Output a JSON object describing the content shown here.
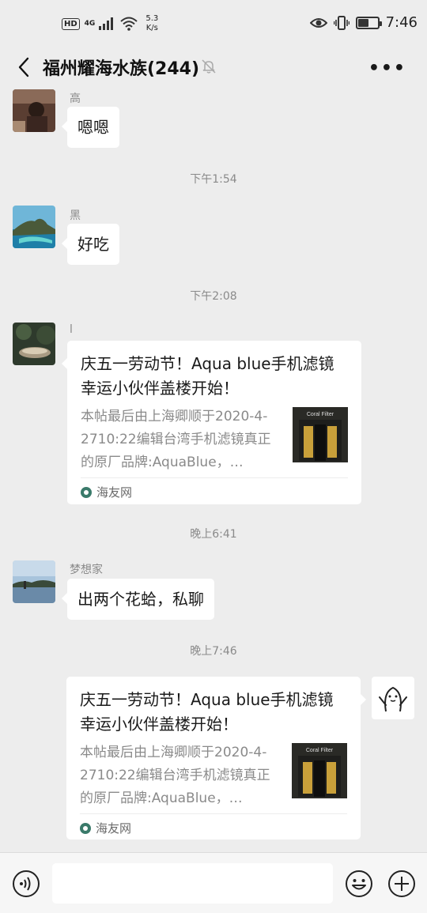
{
  "status_bar": {
    "hd": "HD",
    "network_type": "4G",
    "speed_value": "5.3",
    "speed_unit": "K/s",
    "time": "7:46",
    "battery_level": 0.55,
    "icons": [
      "eye-icon",
      "vibrate-icon",
      "battery-icon",
      "wifi-icon",
      "signal-icon"
    ]
  },
  "nav": {
    "title": "福州耀海水族(244)",
    "muted": true
  },
  "messages": [
    {
      "sender": "高",
      "text": "嗯嗯"
    },
    {
      "timestamp": "下午1:54"
    },
    {
      "sender": "黑",
      "text": "好吃"
    },
    {
      "timestamp": "下午2:08"
    },
    {
      "sender": "l",
      "card": {
        "title": "庆五一劳动节！Aqua blue手机滤镜幸运小伙伴盖楼开始！",
        "desc": "本帖最后由上海卿顺于2020-4-2710:22编辑台湾手机滤镜真正的原厂品牌:AquaBlue，…",
        "thumb_label": "Coral Filter",
        "source": "海友网"
      }
    },
    {
      "timestamp": "晚上6:41"
    },
    {
      "sender": "梦想家",
      "text": "出两个花蛤，私聊"
    },
    {
      "timestamp": "晚上7:46"
    },
    {
      "self": true,
      "card": {
        "title": "庆五一劳动节！Aqua blue手机滤镜幸运小伙伴盖楼开始！",
        "desc": "本帖最后由上海卿顺于2020-4-2710:22编辑台湾手机滤镜真正的原厂品牌:AquaBlue，…",
        "thumb_label": "Coral Filter",
        "source": "海友网"
      }
    }
  ],
  "input_bar": {
    "text_value": "",
    "icons": [
      "voice-icon",
      "emoji-icon",
      "plus-icon"
    ]
  }
}
